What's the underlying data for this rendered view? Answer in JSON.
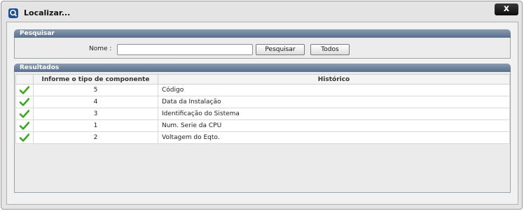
{
  "window": {
    "title": "Localizar...",
    "close_label": "x"
  },
  "search": {
    "header": "Pesquisar",
    "nome_label": "Nome :",
    "nome_value": "",
    "pesquisar_label": "Pesquisar",
    "todos_label": "Todos"
  },
  "results": {
    "header": "Resultados",
    "columns": [
      "",
      "Informe o tipo de componente",
      "Histórico"
    ],
    "rows": [
      {
        "code": "5",
        "historico": "Código"
      },
      {
        "code": "4",
        "historico": "Data da Instalação"
      },
      {
        "code": "3",
        "historico": "Identificação do Sistema"
      },
      {
        "code": "1",
        "historico": "Num. Serie da CPU"
      },
      {
        "code": "2",
        "historico": "Voltagem do Eqto."
      }
    ]
  },
  "colors": {
    "panel_header": "#5a6f8c",
    "check_green": "#3aa81e",
    "close_button": "#111111"
  }
}
